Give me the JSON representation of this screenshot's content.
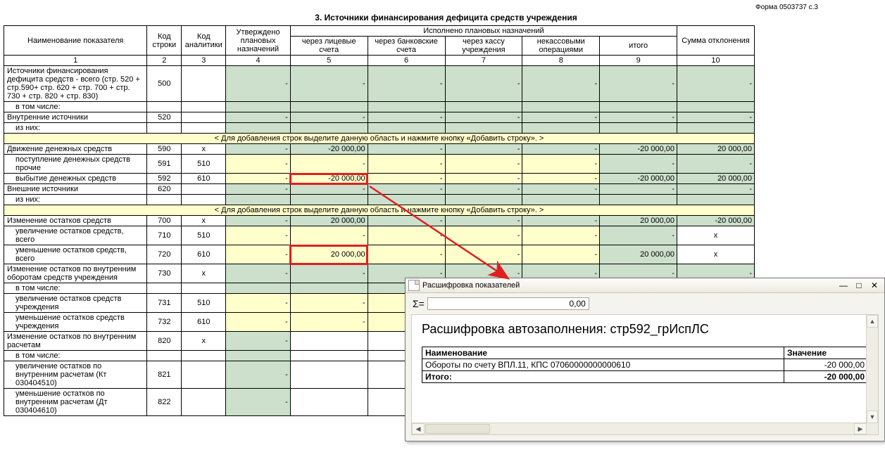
{
  "form_label": "Форма 0503737   с.3",
  "title": "3. Источники финансирования дефицита средств учреждения",
  "headers": {
    "name": "Наименование показателя",
    "code": "Код строки",
    "anal": "Код аналитики",
    "approved": "Утверждено плановых назначений",
    "exec": "Исполнено плановых назначений",
    "exec_cols": {
      "lic": "через лицевые счета",
      "bank": "через банковские счета",
      "kassa": "через кассу учреждения",
      "nekass": "некассовыми операциями",
      "itogo": "итого"
    },
    "dev": "Сумма отклонения"
  },
  "colnums": [
    "1",
    "2",
    "3",
    "4",
    "5",
    "6",
    "7",
    "8",
    "9",
    "10"
  ],
  "addrow_text": "< Для добавления строк выделите данную область и нажмите кнопку «Добавить строку». >",
  "rows": [
    {
      "name": "Источники финансирования дефицита средств - всего (стр. 520 + стр.590+ стр. 620 + стр. 700 + стр. 730 + стр. 820 + стр. 830)",
      "indent": false,
      "code": "500",
      "anal": "",
      "cells": {
        "appr": "-",
        "lic": "-",
        "bank": "-",
        "kassa": "-",
        "nekass": "-",
        "itogo": "-",
        "dev": "-"
      },
      "greencols": [
        "appr",
        "lic",
        "bank",
        "kassa",
        "nekass",
        "itogo",
        "dev"
      ]
    },
    {
      "name": "в том числе:",
      "indent": true,
      "code": "",
      "anal": "",
      "cells": {},
      "greencols": [
        "appr",
        "lic",
        "bank",
        "kassa",
        "nekass",
        "itogo",
        "dev"
      ],
      "noborder_top": true
    },
    {
      "name": "Внутренние источники",
      "indent": false,
      "code": "520",
      "anal": "",
      "cells": {
        "appr": "-",
        "lic": "-",
        "bank": "-",
        "kassa": "-",
        "nekass": "-",
        "itogo": "-",
        "dev": "-"
      },
      "greencols": [
        "appr",
        "lic",
        "bank",
        "kassa",
        "nekass",
        "itogo",
        "dev"
      ]
    },
    {
      "name": "из них:",
      "indent": true,
      "code": "",
      "anal": "",
      "cells": {},
      "greencols": [
        "appr",
        "lic",
        "bank",
        "kassa",
        "nekass",
        "itogo",
        "dev"
      ]
    }
  ],
  "rows2": [
    {
      "name": "Движение денежных средств",
      "indent": false,
      "code": "590",
      "anal": "x",
      "cells": {
        "appr": "-",
        "lic": "-20 000,00",
        "bank": "-",
        "kassa": "-",
        "nekass": "-",
        "itogo": "-20 000,00",
        "dev": "20 000,00"
      },
      "greencols": [
        "appr",
        "lic",
        "bank",
        "kassa",
        "nekass",
        "itogo",
        "dev"
      ]
    },
    {
      "name": "поступление денежных средств прочие",
      "indent": true,
      "code": "591",
      "anal": "510",
      "cells": {
        "appr": "-",
        "lic": "-",
        "bank": "-",
        "kassa": "-",
        "nekass": "-",
        "itogo": "-",
        "dev": "-"
      },
      "yellowcols": [
        "appr",
        "lic",
        "bank",
        "kassa",
        "nekass"
      ],
      "greencols": [
        "itogo",
        "dev"
      ]
    },
    {
      "name": "выбытие денежных средств",
      "indent": true,
      "code": "592",
      "anal": "610",
      "cells": {
        "appr": "-",
        "lic": "-20 000,00",
        "bank": "-",
        "kassa": "-",
        "nekass": "-",
        "itogo": "-20 000,00",
        "dev": "20 000,00"
      },
      "yellowcols": [
        "appr",
        "lic",
        "bank",
        "kassa",
        "nekass"
      ],
      "greencols": [
        "itogo",
        "dev"
      ],
      "hl": "lic"
    },
    {
      "name": "Внешние источники",
      "indent": false,
      "code": "620",
      "anal": "",
      "cells": {
        "appr": "-",
        "lic": "-",
        "bank": "-",
        "kassa": "-",
        "nekass": "-",
        "itogo": "-",
        "dev": "-"
      },
      "greencols": [
        "appr",
        "lic",
        "bank",
        "kassa",
        "nekass",
        "itogo",
        "dev"
      ]
    },
    {
      "name": "из них:",
      "indent": true,
      "code": "",
      "anal": "",
      "cells": {},
      "greencols": [
        "appr",
        "lic",
        "bank",
        "kassa",
        "nekass",
        "itogo",
        "dev"
      ]
    }
  ],
  "rows3": [
    {
      "name": "Изменение остатков средств",
      "indent": false,
      "code": "700",
      "anal": "x",
      "cells": {
        "appr": "-",
        "lic": "20 000,00",
        "bank": "-",
        "kassa": "-",
        "nekass": "-",
        "itogo": "20 000,00",
        "dev": "-20 000,00"
      },
      "greencols": [
        "appr",
        "lic",
        "bank",
        "kassa",
        "nekass",
        "itogo",
        "dev"
      ]
    },
    {
      "name": "увеличение остатков средств, всего",
      "indent": true,
      "code": "710",
      "anal": "510",
      "cells": {
        "appr": "-",
        "lic": "-",
        "bank": "-",
        "kassa": "-",
        "nekass": "-",
        "itogo": "-",
        "dev": "x"
      },
      "yellowcols": [
        "appr",
        "lic",
        "bank",
        "kassa",
        "nekass"
      ],
      "greencols": [
        "itogo"
      ],
      "devcenter": true
    },
    {
      "name": "уменьшение остатков средств, всего",
      "indent": true,
      "code": "720",
      "anal": "610",
      "cells": {
        "appr": "-",
        "lic": "20 000,00",
        "bank": "-",
        "kassa": "-",
        "nekass": "-",
        "itogo": "20 000,00",
        "dev": "x"
      },
      "yellowcols": [
        "appr",
        "lic",
        "bank",
        "kassa",
        "nekass"
      ],
      "greencols": [
        "itogo"
      ],
      "hl": "lic",
      "devcenter": true
    },
    {
      "name": "Изменение остатков по внутренним оборотам средств учреждения",
      "indent": false,
      "code": "730",
      "anal": "x",
      "cells": {
        "appr": "-",
        "lic": "-",
        "bank": "-",
        "kassa": "-",
        "nekass": "-",
        "itogo": "-",
        "dev": "-"
      },
      "greencols": [
        "appr",
        "lic",
        "bank",
        "kassa",
        "nekass",
        "itogo",
        "dev"
      ]
    },
    {
      "name": "в том числе:",
      "indent": true,
      "code": "",
      "anal": "",
      "cells": {},
      "greencols": [
        "appr",
        "lic",
        "bank",
        "kassa",
        "nekass",
        "itogo",
        "dev"
      ]
    },
    {
      "name": "увеличение остатков средств учреждения",
      "indent": true,
      "code": "731",
      "anal": "510",
      "cells": {
        "appr": "-",
        "lic": "-",
        "bank": "-",
        "kassa": "-",
        "nekass": "-",
        "itogo": "-",
        "dev": "-"
      },
      "yellowcols": [
        "appr",
        "lic",
        "bank",
        "kassa",
        "nekass"
      ],
      "greencols": [
        "itogo",
        "dev"
      ]
    },
    {
      "name": "уменьшение остатков средств учреждения",
      "indent": true,
      "code": "732",
      "anal": "610",
      "cells": {
        "appr": "-",
        "lic": "-",
        "bank": "-",
        "kassa": "-",
        "nekass": "-",
        "itogo": "-",
        "dev": "-"
      },
      "yellowcols": [
        "appr",
        "lic",
        "bank",
        "kassa",
        "nekass"
      ],
      "greencols": [
        "itogo",
        "dev"
      ]
    },
    {
      "name": "Изменение остатков по внутренним расчетам",
      "indent": false,
      "code": "820",
      "anal": "x",
      "cells": {
        "appr": "-",
        "lic": "",
        "bank": "",
        "kassa": "",
        "nekass": "",
        "itogo": "",
        "dev": ""
      },
      "greencols": [
        "appr",
        "itogo",
        "dev"
      ]
    },
    {
      "name": "в том числе:",
      "indent": true,
      "code": "",
      "anal": "",
      "cells": {},
      "greencols": [
        "appr",
        "itogo",
        "dev"
      ]
    },
    {
      "name": "увеличение остатков по внутренним расчетам (Кт 030404510)",
      "indent": true,
      "code": "821",
      "anal": "",
      "cells": {
        "appr": "-",
        "lic": "",
        "bank": "",
        "kassa": "",
        "nekass": "",
        "itogo": "",
        "dev": ""
      },
      "greencols": [
        "appr",
        "itogo",
        "dev"
      ]
    },
    {
      "name": "уменьшение остатков по внутренним расчетам (Дт 030404610)",
      "indent": true,
      "code": "822",
      "anal": "",
      "cells": {
        "appr": "-",
        "lic": "",
        "bank": "",
        "kassa": "",
        "nekass": "",
        "itogo": "",
        "dev": ""
      },
      "greencols": [
        "appr",
        "itogo",
        "dev"
      ]
    }
  ],
  "popup": {
    "title": "Расшифровка показателей",
    "sigma": "Σ=",
    "sigma_value": "0,00",
    "heading": "Расшифровка автозаполнения: стр592_грИспЛС",
    "th_name": "Наименование",
    "th_val": "Значение",
    "rows": [
      {
        "name": "Обороты по счету ВПЛ.11, КПС 07060000000000610",
        "val": "-20 000,00"
      }
    ],
    "itogo_label": "Итого:",
    "itogo_val": "-20 000,00"
  }
}
